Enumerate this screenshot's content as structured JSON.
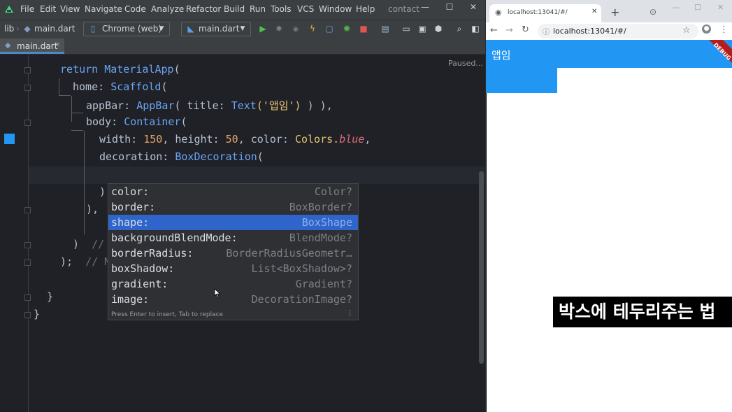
{
  "ide": {
    "menu": [
      "File",
      "Edit",
      "View",
      "Navigate",
      "Code",
      "Analyze",
      "Refactor",
      "Build",
      "Run",
      "Tools",
      "VCS",
      "Window",
      "Help"
    ],
    "window_title": "contact",
    "window_controls": {
      "minimize": "—",
      "maximize": "☐",
      "close": "✕"
    },
    "toolbar": {
      "breadcrumb_root": "lib",
      "breadcrumb_file": "main.dart",
      "device_selector": "Chrome (web)",
      "run_config": "main.dart"
    },
    "tab": {
      "label": "main.dart",
      "close": "✕"
    },
    "status": "Paused...",
    "code": {
      "l1_kw": "return",
      "l1_cls": "MaterialApp",
      "l1_end": "(",
      "l2_prop": "home:",
      "l2_cls": "Scaffold",
      "l2_end": "(",
      "l3_prop": "appBar:",
      "l3_cls": "AppBar",
      "l3_mid": "( title:",
      "l3_cls2": "Text",
      "l3_str": "('앱임')",
      "l3_end": ") ),",
      "l4_prop": "body:",
      "l4_cls": "Container",
      "l4_end": "(",
      "l5_a": "width:",
      "l5_num1": "150",
      "l5_b": ", height:",
      "l5_num2": "50",
      "l5_c": ", color:",
      "l5_col": "Colors.",
      "l5_ital": "blue",
      "l5_end": ",",
      "l6_prop": "decoration:",
      "l6_cls": "BoxDecoration",
      "l6_end": "(",
      "l8": ")",
      "l9": "),",
      "l11": ")",
      "l11_cm": "//",
      "l12": ");",
      "l12_cm": "// M",
      "l14": "}",
      "l15": "}"
    },
    "completion": {
      "items": [
        {
          "name": "color:",
          "type": "Color?"
        },
        {
          "name": "border:",
          "type": "BoxBorder?"
        },
        {
          "name": "shape:",
          "type": "BoxShape"
        },
        {
          "name": "backgroundBlendMode:",
          "type": "BlendMode?"
        },
        {
          "name": "borderRadius:",
          "type": "BorderRadiusGeometr…"
        },
        {
          "name": "boxShadow:",
          "type": "List<BoxShadow>?"
        },
        {
          "name": "gradient:",
          "type": "Gradient?"
        },
        {
          "name": "image:",
          "type": "DecorationImage?"
        }
      ],
      "selected_index": 2,
      "footer": "Press Enter to insert, Tab to replace",
      "more": "⋮"
    }
  },
  "browser": {
    "tab_title": "localhost:13041/#/",
    "tab_close": "✕",
    "new_tab": "+",
    "url": "localhost:13041/#/",
    "window_controls": {
      "minimize": "—",
      "maximize": "☐",
      "close": "✕"
    },
    "app_title": "앱임",
    "debug_banner": "DEBUG",
    "box_color": "#2196f3"
  },
  "caption": "박스에 테두리주는 법"
}
